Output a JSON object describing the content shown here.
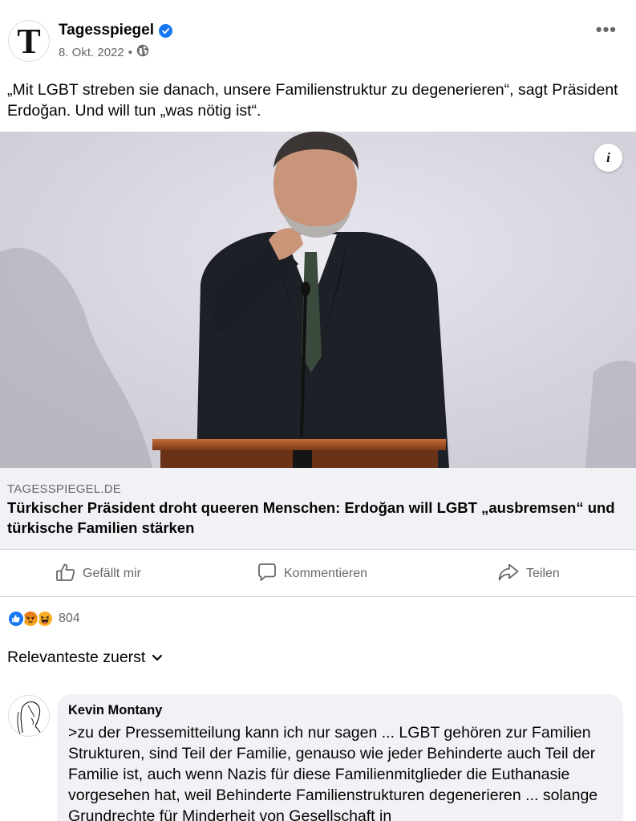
{
  "post": {
    "page_name": "Tagesspiegel",
    "page_logo_letter": "T",
    "date": "8. Okt. 2022",
    "privacy_icon": "globe-icon",
    "more_icon": "more-options-icon",
    "text": "„Mit LGBT streben sie danach, unsere Familienstruktur zu degenerieren“, sagt Präsident Erdoğan. Und will tun „was nötig ist“."
  },
  "photo": {
    "info_label": "i"
  },
  "link": {
    "domain": "TAGESSPIEGEL.DE",
    "title": "Türkischer Präsident droht queeren Menschen: Erdoğan will LGBT „ausbremsen“ und türkische Familien stärken"
  },
  "actions": {
    "like_label": "Gefällt mir",
    "comment_label": "Kommentieren",
    "share_label": "Teilen"
  },
  "reactions": {
    "count": "804",
    "types": [
      "like",
      "angry",
      "haha"
    ]
  },
  "comments": {
    "sort_label": "Relevanteste zuerst",
    "items": [
      {
        "author": "Kevin Montany",
        "text": ">zu der Pressemitteilung kann ich nur sagen ... LGBT gehören zur Familien Strukturen, sind Teil der Familie, genauso wie jeder Behinderte auch Teil der Familie ist, auch wenn Nazis für diese Familienmitglieder die Euthanasie vorgesehen hat, weil Behinderte Familienstrukturen degenerieren ... solange Grundrechte für Minderheit von Gesellschaft in"
      }
    ]
  },
  "colors": {
    "accent": "#1877f2",
    "secondary_text": "#65676b",
    "surface": "#f0f2f5"
  }
}
